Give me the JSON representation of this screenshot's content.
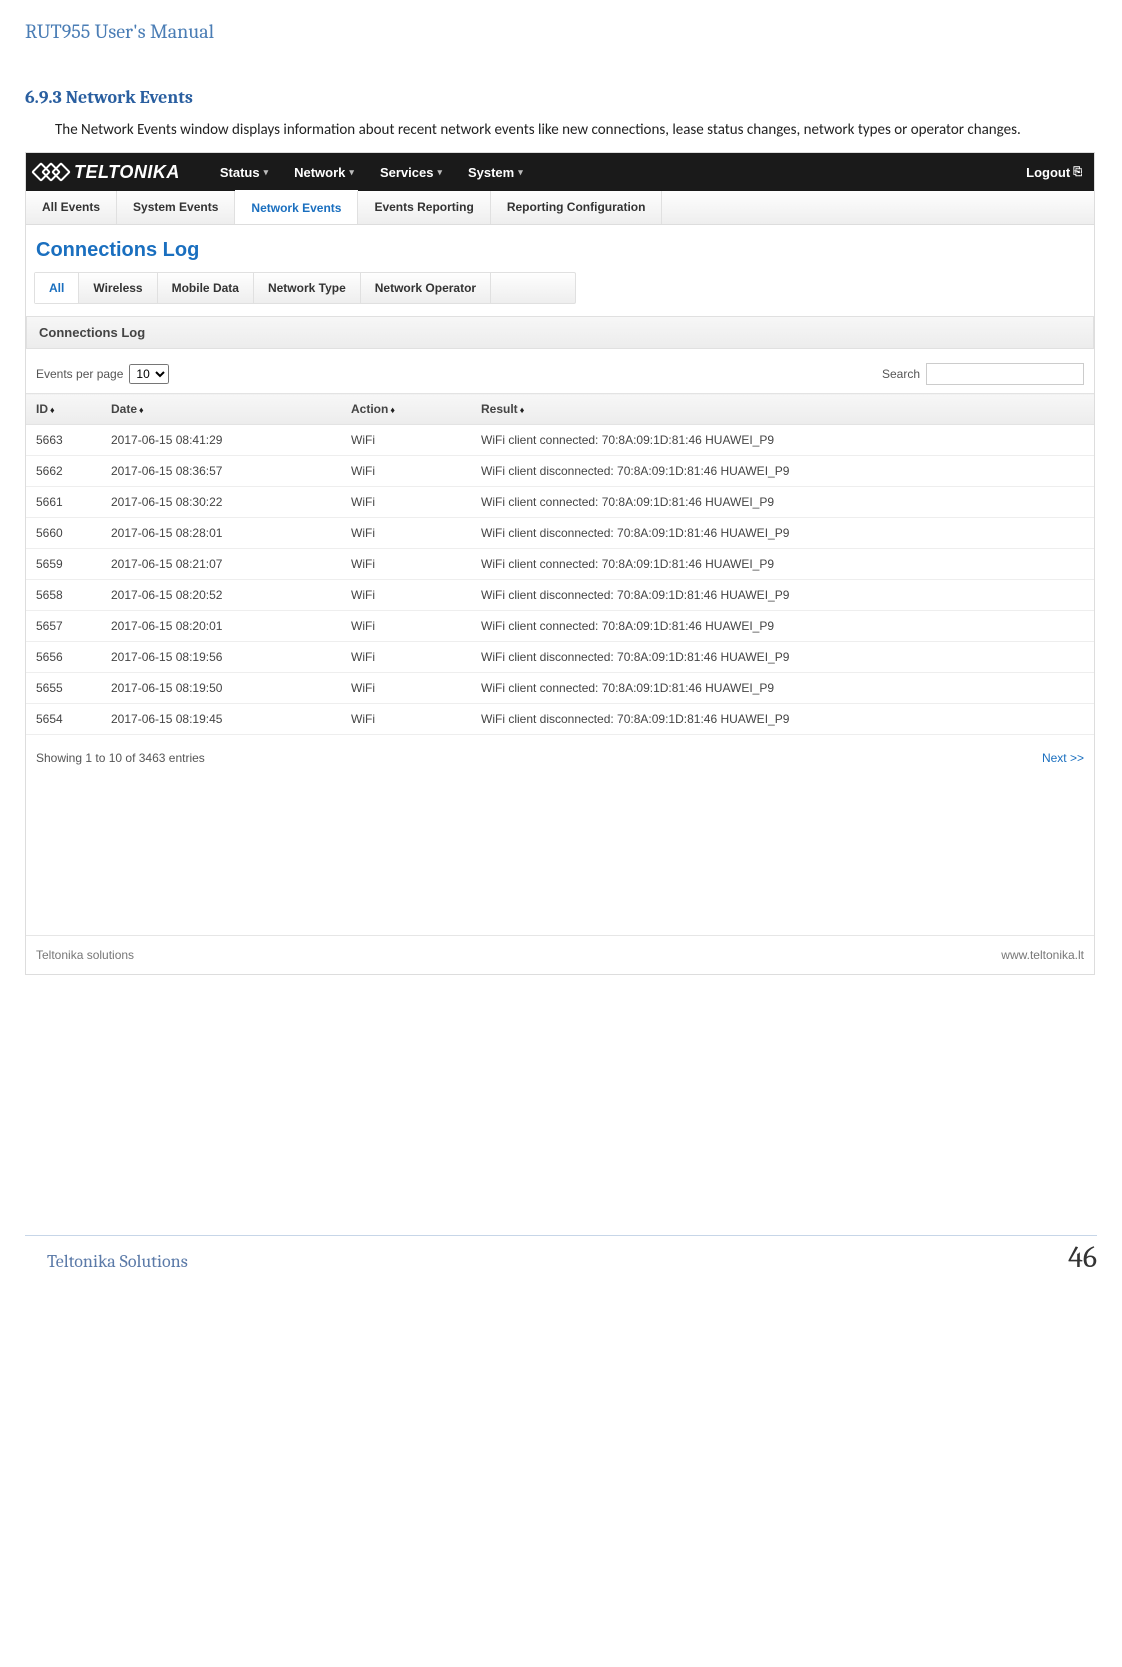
{
  "doc": {
    "header": "RUT955 User's Manual",
    "section_number": "6.9.3",
    "section_title": "Network Events",
    "section_body": "The Network Events window displays information about recent network events like new connections, lease status changes, network types or operator changes.",
    "footer_left": "Teltonika Solutions",
    "page_number": "46"
  },
  "topnav": {
    "brand": "TELTONIKA",
    "items": [
      "Status",
      "Network",
      "Services",
      "System"
    ],
    "logout": "Logout"
  },
  "tabs1": {
    "items": [
      "All Events",
      "System Events",
      "Network Events",
      "Events Reporting",
      "Reporting Configuration"
    ],
    "active_index": 2
  },
  "page_heading": "Connections Log",
  "tabs2": {
    "items": [
      "All",
      "Wireless",
      "Mobile Data",
      "Network Type",
      "Network Operator"
    ],
    "active_index": 0
  },
  "panel_title": "Connections Log",
  "controls": {
    "events_per_page_label": "Events per page",
    "events_per_page_value": "10",
    "search_label": "Search"
  },
  "table": {
    "columns": [
      "ID",
      "Date",
      "Action",
      "Result"
    ],
    "rows": [
      {
        "id": "5663",
        "date": "2017-06-15 08:41:29",
        "action": "WiFi",
        "result": "WiFi client connected: 70:8A:09:1D:81:46 HUAWEI_P9"
      },
      {
        "id": "5662",
        "date": "2017-06-15 08:36:57",
        "action": "WiFi",
        "result": "WiFi client disconnected: 70:8A:09:1D:81:46 HUAWEI_P9"
      },
      {
        "id": "5661",
        "date": "2017-06-15 08:30:22",
        "action": "WiFi",
        "result": "WiFi client connected: 70:8A:09:1D:81:46 HUAWEI_P9"
      },
      {
        "id": "5660",
        "date": "2017-06-15 08:28:01",
        "action": "WiFi",
        "result": "WiFi client disconnected: 70:8A:09:1D:81:46 HUAWEI_P9"
      },
      {
        "id": "5659",
        "date": "2017-06-15 08:21:07",
        "action": "WiFi",
        "result": "WiFi client connected: 70:8A:09:1D:81:46 HUAWEI_P9"
      },
      {
        "id": "5658",
        "date": "2017-06-15 08:20:52",
        "action": "WiFi",
        "result": "WiFi client disconnected: 70:8A:09:1D:81:46 HUAWEI_P9"
      },
      {
        "id": "5657",
        "date": "2017-06-15 08:20:01",
        "action": "WiFi",
        "result": "WiFi client connected: 70:8A:09:1D:81:46 HUAWEI_P9"
      },
      {
        "id": "5656",
        "date": "2017-06-15 08:19:56",
        "action": "WiFi",
        "result": "WiFi client disconnected: 70:8A:09:1D:81:46 HUAWEI_P9"
      },
      {
        "id": "5655",
        "date": "2017-06-15 08:19:50",
        "action": "WiFi",
        "result": "WiFi client connected: 70:8A:09:1D:81:46 HUAWEI_P9"
      },
      {
        "id": "5654",
        "date": "2017-06-15 08:19:45",
        "action": "WiFi",
        "result": "WiFi client disconnected: 70:8A:09:1D:81:46 HUAWEI_P9"
      }
    ],
    "showing_text": "Showing 1 to 10 of 3463 entries",
    "next_label": "Next >>"
  },
  "screenshot_footer": {
    "left": "Teltonika solutions",
    "right": "www.teltonika.lt"
  }
}
